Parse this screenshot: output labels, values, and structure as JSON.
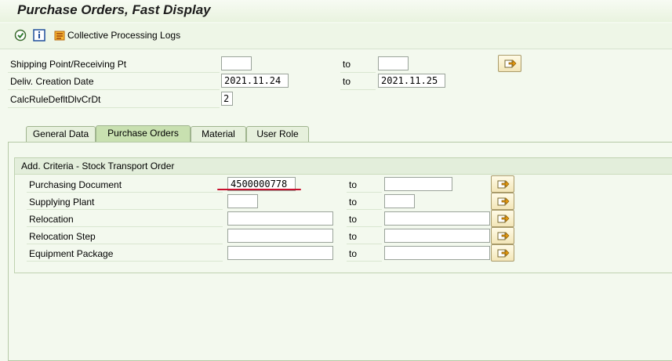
{
  "window": {
    "title": "Purchase Orders, Fast Display"
  },
  "toolbar": {
    "execute_icon": "execute-icon",
    "info_icon": "info-icon",
    "logs_icon": "logs-icon",
    "logs_label": "Collective Processing Logs"
  },
  "header_fields": [
    {
      "label": "Shipping Point/Receiving Pt",
      "from": "",
      "to_label": "to",
      "to": ""
    },
    {
      "label": "Deliv. Creation Date",
      "from": "2021.11.24",
      "to_label": "to",
      "to": "2021.11.25"
    },
    {
      "label": "CalcRuleDefltDlvCrDt",
      "value": "2"
    }
  ],
  "tabs": [
    {
      "label": "General Data",
      "active": false
    },
    {
      "label": "Purchase Orders",
      "active": true
    },
    {
      "label": "Material",
      "active": false
    },
    {
      "label": "User Role",
      "active": false
    }
  ],
  "group": {
    "title": "Add. Criteria - Stock Transport Order",
    "rows": [
      {
        "label": "Purchasing Document",
        "from": "4500000778",
        "to_label": "to",
        "to": ""
      },
      {
        "label": "Supplying Plant",
        "from": "",
        "to_label": "to",
        "to": ""
      },
      {
        "label": "Relocation",
        "from": "",
        "to_label": "to",
        "to": ""
      },
      {
        "label": "Relocation Step",
        "from": "",
        "to_label": "to",
        "to": ""
      },
      {
        "label": "Equipment Package",
        "from": "",
        "to_label": "to",
        "to": ""
      }
    ]
  },
  "colors": {
    "highlight_underline": "#c8102e",
    "tab_active": "#c8e0b0"
  }
}
